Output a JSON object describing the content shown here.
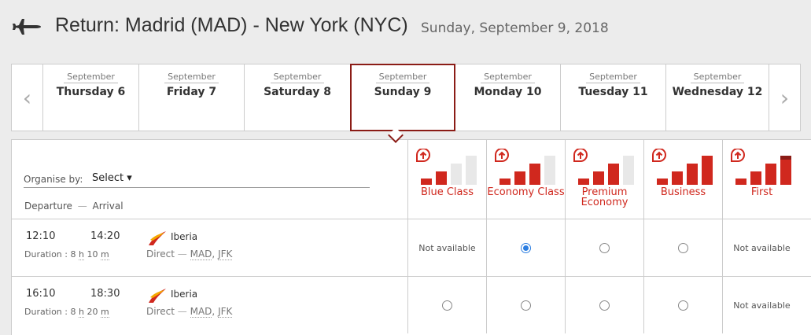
{
  "header": {
    "title": "Return: Madrid (MAD) - New York (NYC)",
    "date": "Sunday, September 9, 2018"
  },
  "days": [
    {
      "month": "September",
      "day": "Thursday 6"
    },
    {
      "month": "September",
      "day": "Friday 7"
    },
    {
      "month": "September",
      "day": "Saturday 8"
    },
    {
      "month": "September",
      "day": "Sunday 9",
      "selected": true
    },
    {
      "month": "September",
      "day": "Monday 10"
    },
    {
      "month": "September",
      "day": "Tuesday 11"
    },
    {
      "month": "September",
      "day": "Wednesday 12"
    }
  ],
  "organise": {
    "label": "Organise by:",
    "value": "Select ▾"
  },
  "columns_header": {
    "departure": "Departure",
    "separator": "—",
    "arrival": "Arrival"
  },
  "classes": [
    {
      "label": "Blue Class",
      "level": 2
    },
    {
      "label": "Economy Class",
      "level": 3
    },
    {
      "label": "Premium Economy",
      "level": 3
    },
    {
      "label": "Business",
      "level": 4
    },
    {
      "label": "First",
      "level": 4
    }
  ],
  "flights": [
    {
      "depart": "12:10",
      "arrive": "14:20",
      "duration_label": "Duration :",
      "duration_h": "8",
      "h_unit": "h",
      "duration_m": "10",
      "m_unit": "m",
      "airline": "Iberia",
      "type": "Direct",
      "dash": "—",
      "origin": "MAD",
      "comma": ",",
      "dest": "JFK",
      "cells": [
        "Not available",
        "checked",
        "radio",
        "radio",
        "Not available"
      ]
    },
    {
      "depart": "16:10",
      "arrive": "18:30",
      "duration_label": "Duration :",
      "duration_h": "8",
      "h_unit": "h",
      "duration_m": "20",
      "m_unit": "m",
      "airline": "Iberia",
      "type": "Direct",
      "dash": "—",
      "origin": "MAD",
      "comma": ",",
      "dest": "JFK",
      "cells": [
        "radio",
        "radio",
        "radio",
        "radio",
        "Not available"
      ]
    }
  ],
  "colors": {
    "accent": "#d0281e",
    "selected_border": "#8b1c16",
    "radio_checked": "#2a7de1"
  }
}
